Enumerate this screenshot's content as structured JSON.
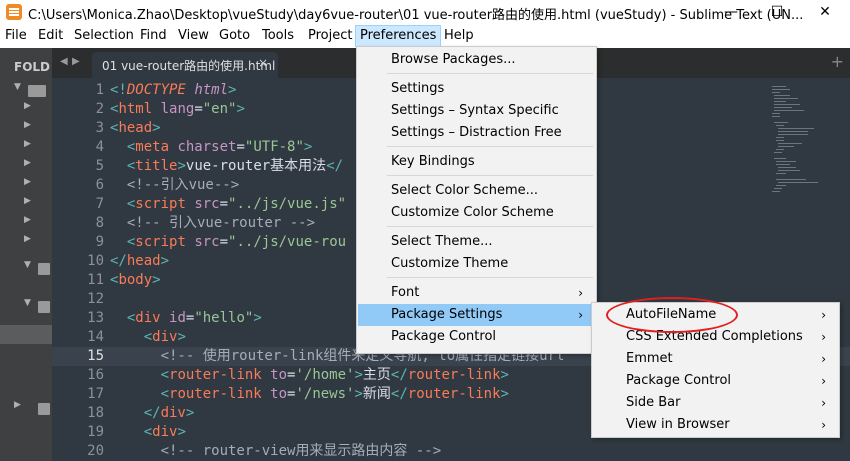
{
  "window": {
    "title": "C:\\Users\\Monica.Zhao\\Desktop\\vueStudy\\day6vue-router\\01 vue-router路由的使用.html (vueStudy) - Sublime Text (UN...",
    "minimize": "—",
    "maximize": "☐",
    "close": "✕"
  },
  "menubar": {
    "items": [
      "File",
      "Edit",
      "Selection",
      "Find",
      "View",
      "Goto",
      "Tools",
      "Project",
      "Preferences",
      "Help"
    ],
    "active": "Preferences"
  },
  "sidebar": {
    "header": "FOLD"
  },
  "tabbar": {
    "prev": "◀",
    "next": "▶",
    "tab_label": "01 vue-router路由的使用.html",
    "tab_close": "×",
    "new_tab": "+"
  },
  "editor": {
    "line_numbers": [
      "1",
      "2",
      "3",
      "4",
      "5",
      "6",
      "7",
      "8",
      "9",
      "10",
      "11",
      "12",
      "13",
      "14",
      "15",
      "16",
      "17",
      "18",
      "19",
      "20"
    ],
    "current_line": "15"
  },
  "preferences_menu": {
    "items": [
      "Browse Packages...",
      "Settings",
      "Settings – Syntax Specific",
      "Settings – Distraction Free",
      "Key Bindings",
      "Select Color Scheme...",
      "Customize Color Scheme",
      "Select Theme...",
      "Customize Theme",
      "Font",
      "Package Settings",
      "Package Control"
    ],
    "highlighted": "Package Settings",
    "submenu_arrow": "›"
  },
  "package_settings_submenu": {
    "items": [
      "AutoFileName",
      "CSS Extended Completions",
      "Emmet",
      "Package Control",
      "Side Bar",
      "View in Browser"
    ],
    "annotated": "AutoFileName"
  },
  "colors": {
    "editor_bg": "#303841",
    "highlight": "#91c9f7",
    "annotation": "#e02020"
  }
}
